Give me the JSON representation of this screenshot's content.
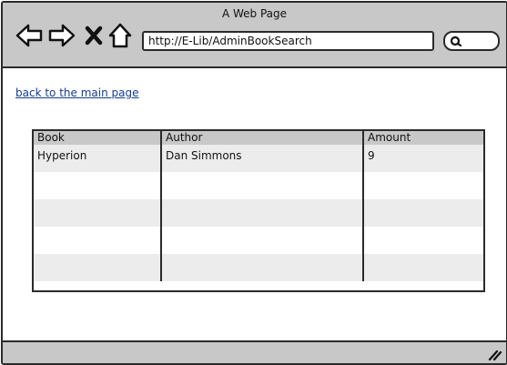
{
  "window": {
    "title": "A Web Page"
  },
  "browser": {
    "url": "http://E-Lib/AdminBookSearch",
    "icons": [
      "back-arrow-icon",
      "forward-arrow-icon",
      "stop-icon",
      "home-icon",
      "search-icon"
    ]
  },
  "page": {
    "back_link": "back to the main page"
  },
  "table": {
    "columns": [
      "Book",
      "Author",
      "Amount"
    ],
    "rows": [
      [
        "Hyperion",
        "Dan Simmons",
        "9"
      ],
      [
        "",
        "",
        ""
      ],
      [
        "",
        "",
        ""
      ],
      [
        "",
        "",
        ""
      ],
      [
        "",
        "",
        ""
      ]
    ]
  },
  "colors": {
    "chrome": "#c8c8c8",
    "link": "#163e8c",
    "row_alt": "#ececec",
    "border": "#2b2b2b"
  }
}
